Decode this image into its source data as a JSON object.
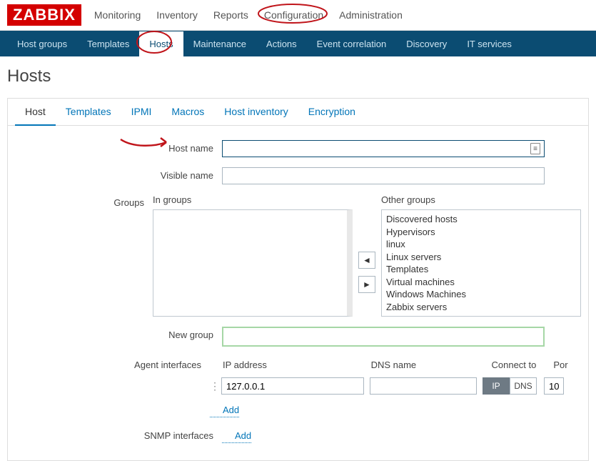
{
  "brand": "ZABBIX",
  "topnav": [
    "Monitoring",
    "Inventory",
    "Reports",
    "Configuration",
    "Administration"
  ],
  "subnav": [
    "Host groups",
    "Templates",
    "Hosts",
    "Maintenance",
    "Actions",
    "Event correlation",
    "Discovery",
    "IT services"
  ],
  "page_title": "Hosts",
  "tabs": [
    "Host",
    "Templates",
    "IPMI",
    "Macros",
    "Host inventory",
    "Encryption"
  ],
  "labels": {
    "host_name": "Host name",
    "visible_name": "Visible name",
    "groups": "Groups",
    "in_groups": "In groups",
    "other_groups": "Other groups",
    "new_group": "New group",
    "agent_if": "Agent interfaces",
    "snmp_if": "SNMP interfaces",
    "add": "Add",
    "ip_addr": "IP address",
    "dns_name": "DNS name",
    "connect_to": "Connect to",
    "port": "Por",
    "conn_ip": "IP",
    "conn_dns": "DNS"
  },
  "values": {
    "host_name": "",
    "visible_name": "",
    "new_group": "",
    "if_ip": "127.0.0.1",
    "if_dns": "",
    "if_port": "10"
  },
  "other_groups": [
    "Discovered hosts",
    "Hypervisors",
    "linux",
    "Linux servers",
    "Templates",
    "Virtual machines",
    "Windows Machines",
    "Zabbix servers"
  ]
}
